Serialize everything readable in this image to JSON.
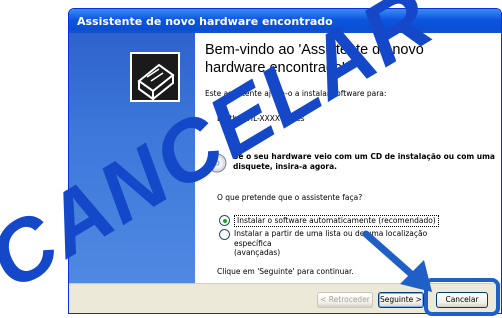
{
  "window": {
    "title": "Assistente de novo hardware encontrado"
  },
  "wizard": {
    "heading": "Bem-vindo ao 'Assistente de novo hardware encontrado'",
    "intro": "Este assistente ajuda-o a instalar software para:",
    "device": "Brother HL-XXXX series",
    "cd_prompt": "Se o seu hardware veio com um CD de instalação ou com uma disquete, insira-a agora.",
    "question": "O que pretende que o assistente faça?",
    "options": [
      {
        "label": "Instalar o software automaticamente (recomendado)",
        "selected": true
      },
      {
        "label": "Instalar a partir de uma lista ou de uma localização específica\n(avançadas)",
        "selected": false
      }
    ],
    "continue_text": "Clique em 'Seguinte' para continuar."
  },
  "buttons": {
    "back": "< Retroceder",
    "next": "Seguinte >",
    "cancel": "Cancelar"
  },
  "overlay": {
    "word": "CANCELAR",
    "word_color": "#1448c8",
    "arrow_color": "#1f5fc6"
  },
  "colors": {
    "titlebar": "#0b56df",
    "banner": "#3d78da",
    "dialog_bg": "#ece9d8",
    "radio_dot": "#21a121"
  }
}
